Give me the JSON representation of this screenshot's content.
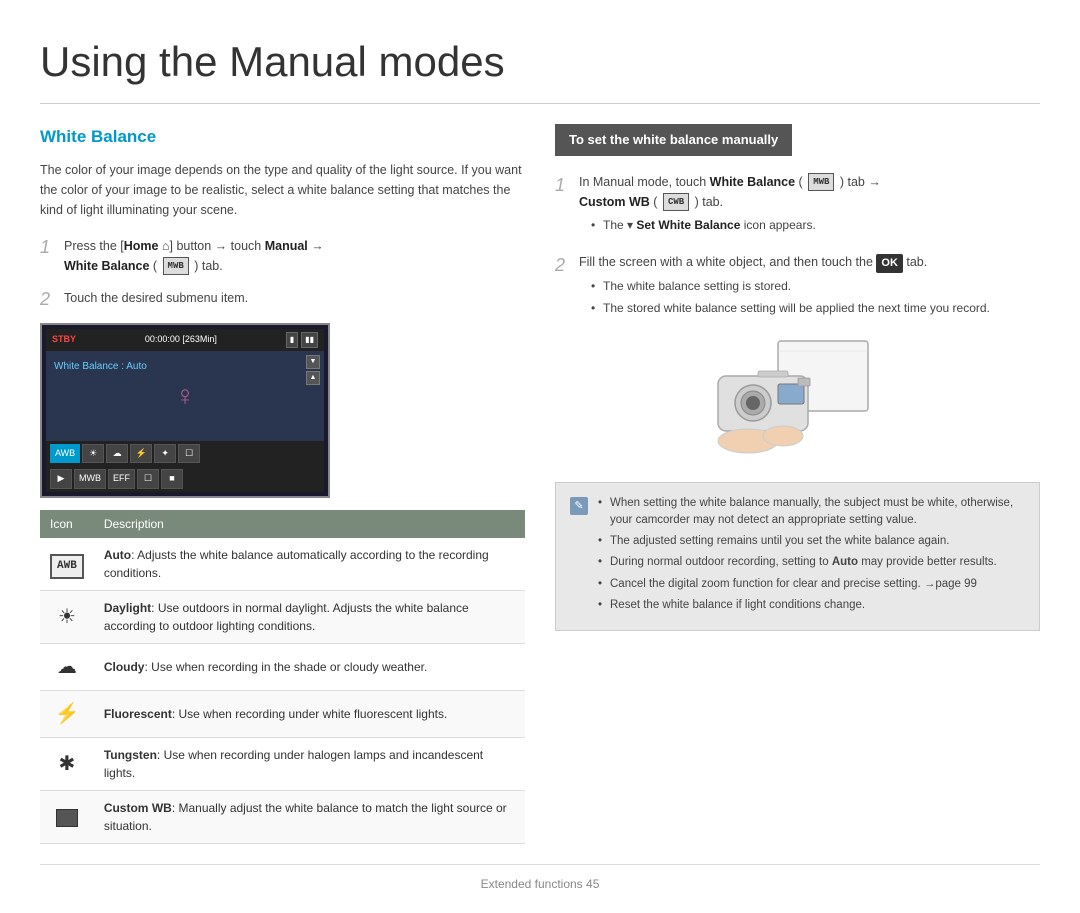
{
  "page": {
    "title": "Using the Manual modes",
    "footer": "Extended functions  45"
  },
  "left": {
    "section_heading": "White Balance",
    "intro": "The color of your image depends on the type and quality of the light source. If you want the color of your image to be realistic, select a white balance setting that matches the kind of light illuminating your scene.",
    "step1_num": "1",
    "step1_text": "Press the [Home",
    "step1_bold1": "] button → touch Manual →",
    "step1_bold2": "White Balance (",
    "step1_icon_label": "MWB",
    "step1_end": ") tab.",
    "step2_num": "2",
    "step2_text": "Touch the desired submenu item.",
    "cam_stby": "STBY",
    "cam_time": "00:00:00 [263Min]",
    "cam_wb_label": "White Balance : Auto",
    "table_col1": "Icon",
    "table_col2": "Description",
    "table_rows": [
      {
        "icon": "AWB",
        "icon_type": "box",
        "title": "Auto",
        "desc": "Adjusts the white balance automatically according to the recording conditions."
      },
      {
        "icon": "☀",
        "icon_type": "unicode",
        "title": "Daylight",
        "desc": "Use outdoors in normal daylight. Adjusts the white balance according to outdoor lighting conditions."
      },
      {
        "icon": "☁",
        "icon_type": "unicode",
        "title": "Cloudy",
        "desc": "Use when recording in the shade or cloudy weather."
      },
      {
        "icon": "⚡",
        "icon_type": "unicode",
        "title": "Fluorescent",
        "desc": "Use when recording under white fluorescent lights."
      },
      {
        "icon": "✱",
        "icon_type": "unicode",
        "title": "Tungsten",
        "desc": "Use when recording under halogen lamps and incandescent lights."
      },
      {
        "icon": "⬛",
        "icon_type": "custom_wb",
        "title": "Custom WB",
        "desc": "Manually adjust the white balance to match the light source or situation."
      }
    ]
  },
  "right": {
    "header": "To set the white balance manually",
    "step1_num": "1",
    "step1_parts": [
      "In Manual mode, touch ",
      "White Balance",
      " (",
      "MWB",
      ") tab →",
      "Custom WB (",
      "CWB",
      ") tab."
    ],
    "step1_bullet": "The  Set White Balance icon appears.",
    "step2_num": "2",
    "step2_text": "Fill the screen with a white object, and then touch the",
    "step2_ok": "OK",
    "step2_end": "tab.",
    "step2_bullets": [
      "The white balance setting is stored.",
      "The stored white balance setting will be applied the next time you record."
    ],
    "note_bullets": [
      "When setting the white balance manually, the subject must be white, otherwise, your camcorder may not detect an appropriate setting value.",
      "The adjusted setting remains until you set the white balance again.",
      "During normal outdoor recording, setting to Auto may provide better results.",
      "Cancel the digital zoom function for clear and precise setting. →page 99",
      "Reset the white balance if light conditions change."
    ]
  }
}
